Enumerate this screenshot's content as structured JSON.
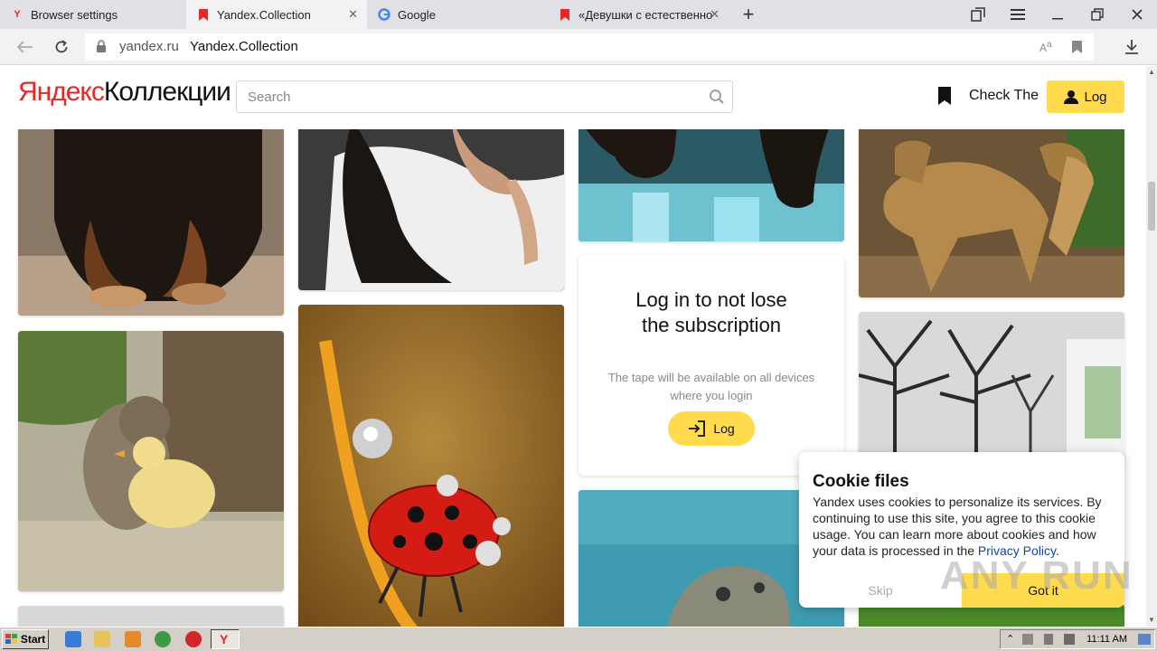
{
  "browser": {
    "tabs": [
      {
        "label": "Browser settings",
        "icon": "yandex-browser-icon",
        "active": false
      },
      {
        "label": "Yandex.Collection",
        "icon": "bookmark-red-icon",
        "active": true
      },
      {
        "label": "Google",
        "icon": "google-icon",
        "active": false
      },
      {
        "label": "«Девушки с естественно",
        "icon": "bookmark-red-icon",
        "active": false
      }
    ],
    "new_tab_symbol": "+",
    "address": {
      "domain": "yandex.ru",
      "title": "Yandex.Collection"
    }
  },
  "header": {
    "logo_part1": "Яндекс",
    "logo_part2": "Коллекции",
    "search_placeholder": "Search",
    "check_label": "Check The",
    "login_label": "Log"
  },
  "login_card": {
    "title": "Log in to not lose the subscription",
    "text": "The tape will be available on all devices where you login",
    "button_label": "Log"
  },
  "cookie": {
    "title": "Cookie files",
    "text": "Yandex uses cookies to personalize its services. By continuing to use this site, you agree to this cookie usage. You can learn more about cookies and how your data is processed in the",
    "link": "Privacy Policy",
    "link_suffix": ".",
    "skip_label": "Skip",
    "gotit_label": "Got it"
  },
  "cards": [
    {
      "name": "dog-image",
      "alt": "dog paws"
    },
    {
      "name": "girl-image",
      "alt": "girl in white t-shirt"
    },
    {
      "name": "horse-water-image",
      "alt": "horse legs in water"
    },
    {
      "name": "coyotes-image",
      "alt": "coyotes"
    },
    {
      "name": "kitten-duckling-image",
      "alt": "kitten with duckling"
    },
    {
      "name": "ladybug-image",
      "alt": "ladybug on dewy stem"
    },
    {
      "name": "tree-room-image",
      "alt": "room with tree mural"
    },
    {
      "name": "hippo-image",
      "alt": "hippo underwater"
    }
  ],
  "watermark": "ANY RUN",
  "taskbar": {
    "start_label": "Start",
    "clock": "11:11 AM"
  }
}
